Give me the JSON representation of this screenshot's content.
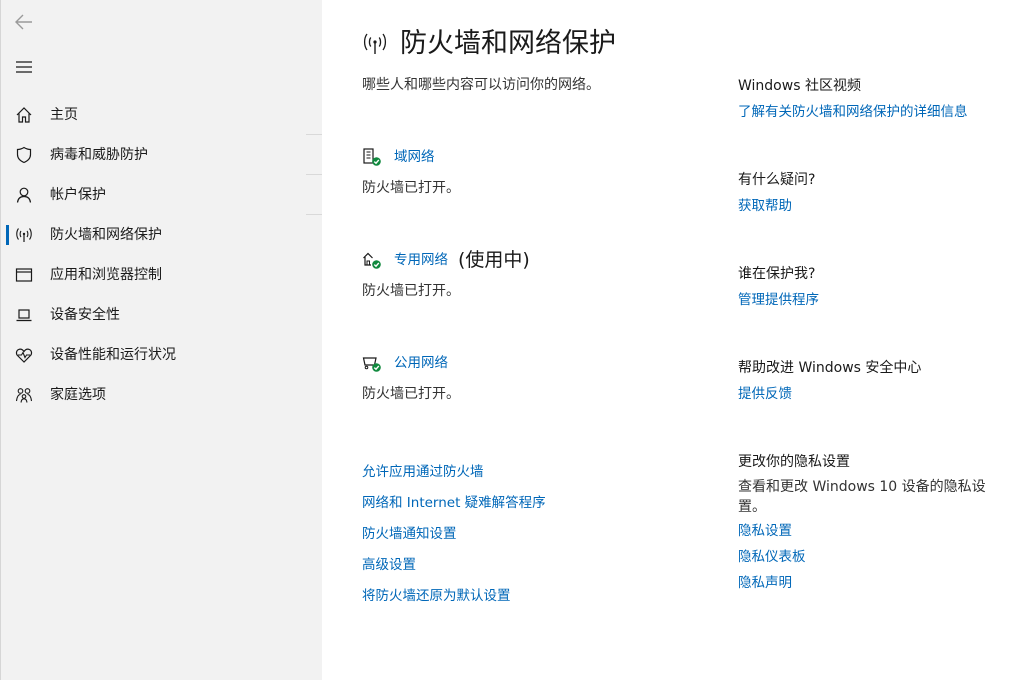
{
  "sidebar": {
    "back_icon": "back-arrow-icon",
    "menu_icon": "hamburger-menu-icon",
    "items": [
      {
        "label": "主页",
        "icon": "home-icon",
        "active": false
      },
      {
        "label": "病毒和威胁防护",
        "icon": "shield-icon",
        "active": false
      },
      {
        "label": "帐户保护",
        "icon": "person-icon",
        "active": false
      },
      {
        "label": "防火墙和网络保护",
        "icon": "wifi-antenna-icon",
        "active": true
      },
      {
        "label": "应用和浏览器控制",
        "icon": "app-window-icon",
        "active": false
      },
      {
        "label": "设备安全性",
        "icon": "laptop-icon",
        "active": false
      },
      {
        "label": "设备性能和运行状况",
        "icon": "heart-pulse-icon",
        "active": false
      },
      {
        "label": "家庭选项",
        "icon": "family-icon",
        "active": false
      }
    ]
  },
  "main": {
    "title": "防火墙和网络保护",
    "subtitle": "哪些人和哪些内容可以访问你的网络。",
    "networks": [
      {
        "name": "域网络",
        "active_label": "",
        "status": "防火墙已打开。",
        "icon": "domain-network-icon"
      },
      {
        "name": "专用网络",
        "active_label": "(使用中)",
        "status": "防火墙已打开。",
        "icon": "private-network-icon"
      },
      {
        "name": "公用网络",
        "active_label": "",
        "status": "防火墙已打开。",
        "icon": "public-network-icon"
      }
    ],
    "links": [
      "允许应用通过防火墙",
      "网络和 Internet 疑难解答程序",
      "防火墙通知设置",
      "高级设置",
      "将防火墙还原为默认设置"
    ]
  },
  "right": {
    "community": {
      "heading": "Windows 社区视频",
      "link": "了解有关防火墙和网络保护的详细信息"
    },
    "question": {
      "heading": "有什么疑问?",
      "link": "获取帮助"
    },
    "protector": {
      "heading": "谁在保护我?",
      "link": "管理提供程序"
    },
    "improve": {
      "heading": "帮助改进 Windows 安全中心",
      "link": "提供反馈"
    },
    "privacy": {
      "heading": "更改你的隐私设置",
      "text": "查看和更改 Windows 10 设备的隐私设置。",
      "links": [
        "隐私设置",
        "隐私仪表板",
        "隐私声明"
      ]
    }
  },
  "colors": {
    "accent": "#0067b8",
    "sidebar_bg": "#f2f2f2",
    "ok_green": "#10893e"
  }
}
